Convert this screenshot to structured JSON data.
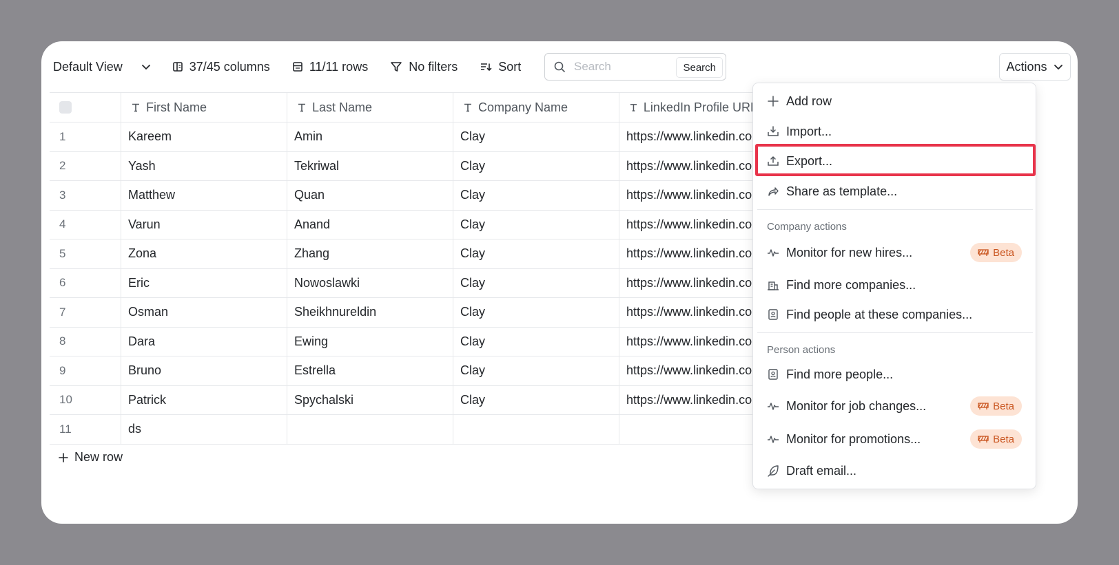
{
  "toolbar": {
    "view_label": "Default View",
    "columns_label": "37/45 columns",
    "rows_label": "11/11 rows",
    "filters_label": "No filters",
    "sort_label": "Sort",
    "search_placeholder": "Search",
    "search_button": "Search",
    "actions_label": "Actions"
  },
  "table": {
    "headers": [
      "First Name",
      "Last Name",
      "Company Name",
      "LinkedIn Profile URL"
    ],
    "rows": [
      {
        "idx": "1",
        "first": "Kareem",
        "last": "Amin",
        "company": "Clay",
        "linkedin": "https://www.linkedin.com"
      },
      {
        "idx": "2",
        "first": "Yash",
        "last": "Tekriwal",
        "company": "Clay",
        "linkedin": "https://www.linkedin.com"
      },
      {
        "idx": "3",
        "first": "Matthew",
        "last": "Quan",
        "company": "Clay",
        "linkedin": "https://www.linkedin.com"
      },
      {
        "idx": "4",
        "first": "Varun",
        "last": "Anand",
        "company": "Clay",
        "linkedin": "https://www.linkedin.com"
      },
      {
        "idx": "5",
        "first": "Zona",
        "last": "Zhang",
        "company": "Clay",
        "linkedin": "https://www.linkedin.com"
      },
      {
        "idx": "6",
        "first": "Eric",
        "last": "Nowoslawki",
        "company": "Clay",
        "linkedin": "https://www.linkedin.com"
      },
      {
        "idx": "7",
        "first": "Osman",
        "last": "Sheikhnureldin",
        "company": "Clay",
        "linkedin": "https://www.linkedin.com"
      },
      {
        "idx": "8",
        "first": "Dara",
        "last": "Ewing",
        "company": "Clay",
        "linkedin": "https://www.linkedin.com"
      },
      {
        "idx": "9",
        "first": "Bruno",
        "last": "Estrella",
        "company": "Clay",
        "linkedin": "https://www.linkedin.com"
      },
      {
        "idx": "10",
        "first": "Patrick",
        "last": "Spychalski",
        "company": "Clay",
        "linkedin": "https://www.linkedin.com"
      },
      {
        "idx": "11",
        "first": "ds",
        "last": "",
        "company": "",
        "linkedin": ""
      }
    ],
    "new_row_label": "New row"
  },
  "menu": {
    "add_row": "Add row",
    "import": "Import...",
    "export": "Export...",
    "share_template": "Share as template...",
    "company_section": "Company actions",
    "monitor_hires": "Monitor for new hires...",
    "find_companies": "Find more companies...",
    "find_people_companies": "Find people at these companies...",
    "person_section": "Person actions",
    "find_people": "Find more people...",
    "monitor_jobs": "Monitor for job changes...",
    "monitor_promotions": "Monitor for promotions...",
    "draft_email": "Draft email...",
    "beta_label": "Beta"
  },
  "colors": {
    "highlight": "#e8334a",
    "beta_bg": "#fde3d4",
    "beta_text": "#c9541e"
  }
}
